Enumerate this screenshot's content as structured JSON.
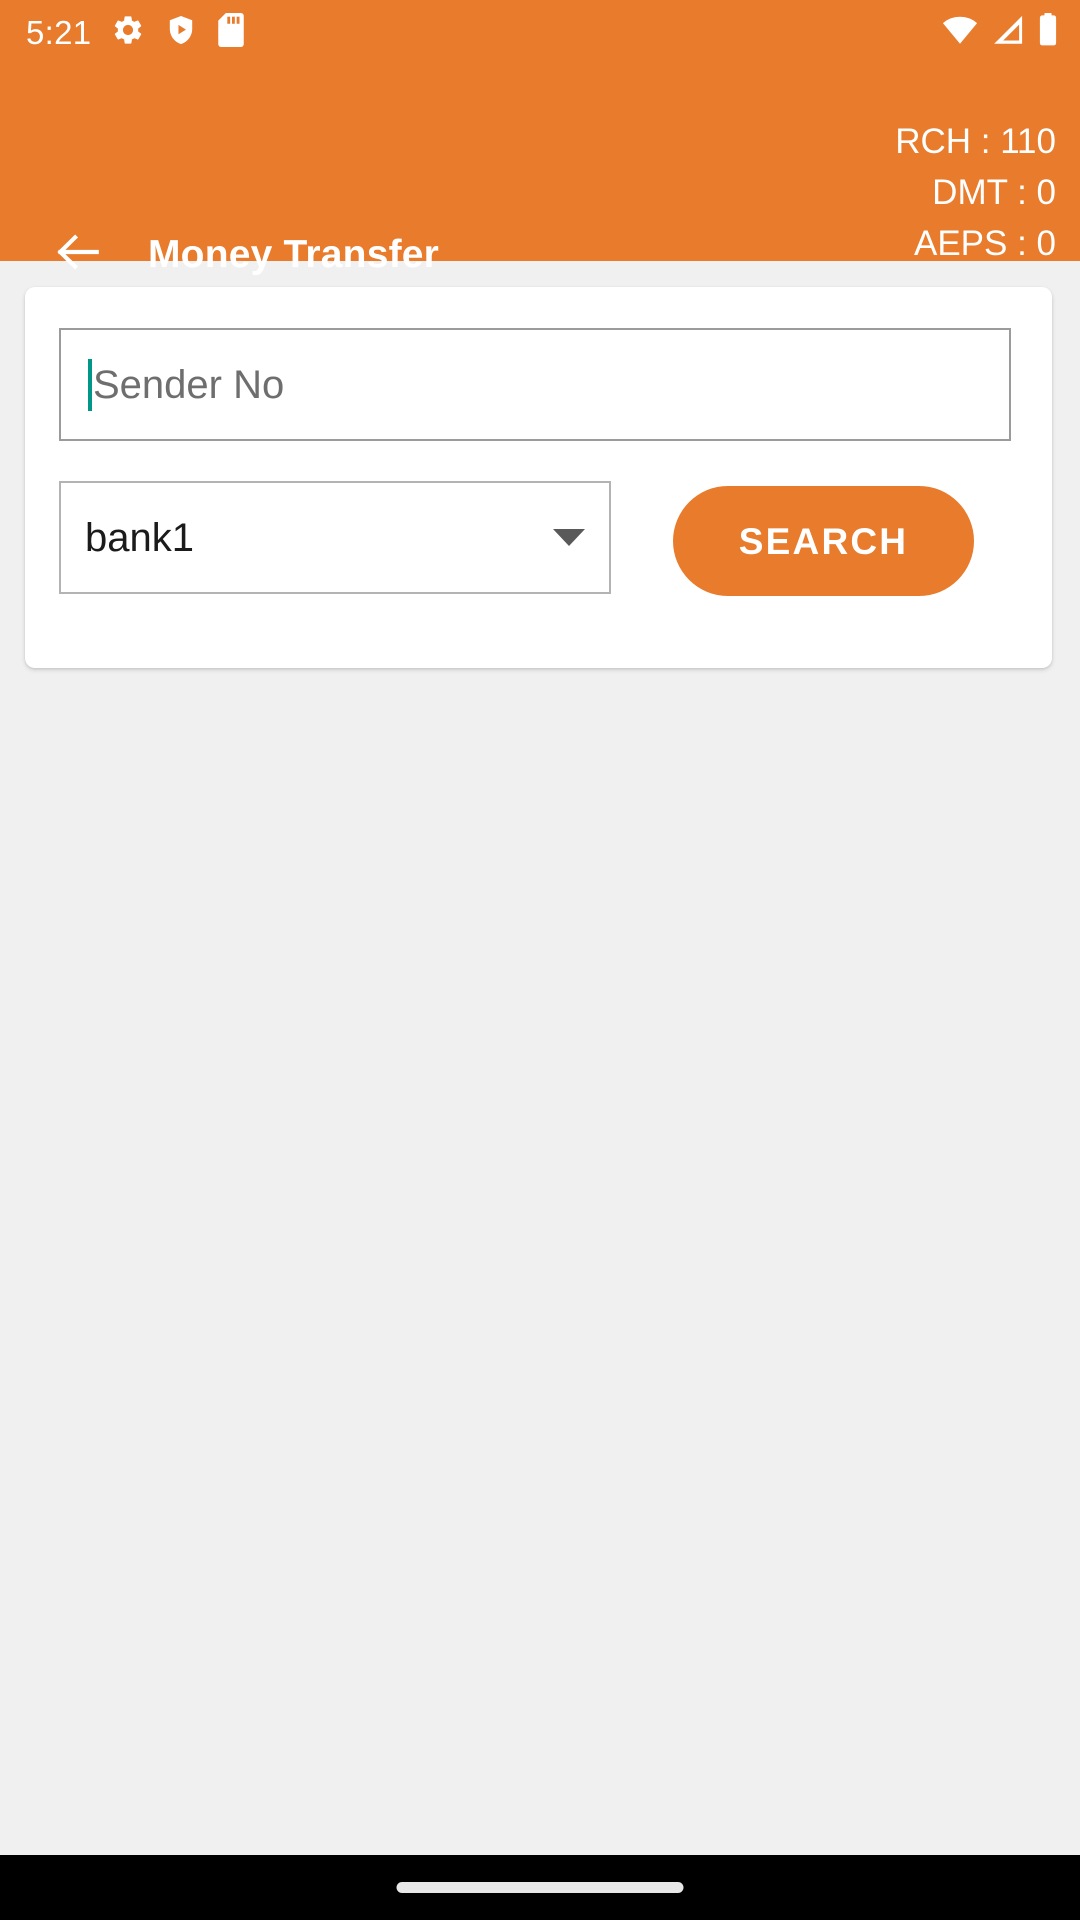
{
  "status_bar": {
    "clock": "5:21",
    "icons_left": [
      "gear-icon",
      "shield-play-icon",
      "sd-card-icon"
    ],
    "icons_right": [
      "wifi-icon",
      "signal-icon",
      "battery-icon"
    ]
  },
  "app_bar": {
    "back_label": "back-arrow-icon",
    "title": "Money Transfer",
    "balances": [
      {
        "label": "RCH",
        "value": "110",
        "text": "RCH : 110"
      },
      {
        "label": "DMT",
        "value": "0",
        "text": "DMT : 0"
      },
      {
        "label": "AEPS",
        "value": "0",
        "text": "AEPS : 0"
      }
    ]
  },
  "form": {
    "sender_number": {
      "value": "",
      "placeholder": "Sender No"
    },
    "bank_select": {
      "selected": "bank1",
      "options": [
        "bank1"
      ]
    },
    "search_button": {
      "label": "SEARCH"
    }
  },
  "colors": {
    "brand_orange": "#e87b2c",
    "page_background": "#f0f0f0",
    "card_background": "#ffffff",
    "caret_teal": "#009688",
    "field_border": "#9b9b9b",
    "select_border": "#b3b3b3",
    "placeholder_text": "#6e6e6e",
    "nav_bar": "#000000"
  }
}
